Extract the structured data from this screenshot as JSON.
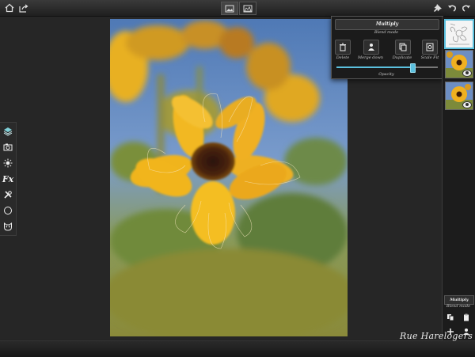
{
  "toolbar": {
    "icons": [
      "home-icon",
      "share-icon",
      "image-view-icon",
      "landscape-view-icon",
      "pin-icon",
      "undo-icon",
      "redo-icon"
    ]
  },
  "tools": {
    "items": [
      "layers-icon",
      "camera-icon",
      "brightness-icon",
      "fx-icon",
      "wrench-icon",
      "circle-icon",
      "mask-icon"
    ],
    "fx_label": "Fx"
  },
  "layer_popup": {
    "blend_value": "Multiply",
    "blend_mode_label": "Blend mode",
    "actions": [
      "Delete",
      "Merge down",
      "Duplicate",
      "Scale Fit"
    ],
    "opacity_label": "Opacity",
    "opacity_value": 0.75
  },
  "layers_panel": {
    "blend_value": "Multiply",
    "blend_mode_label": "Blend mode",
    "layers": [
      "sketch-layer",
      "sunflower-layer-1",
      "sunflower-layer-2"
    ]
  },
  "signature": {
    "text": "Rue Harelogers"
  },
  "colors": {
    "accent": "#5bc0de",
    "panel": "#1b1b1b",
    "background": "#242424"
  }
}
